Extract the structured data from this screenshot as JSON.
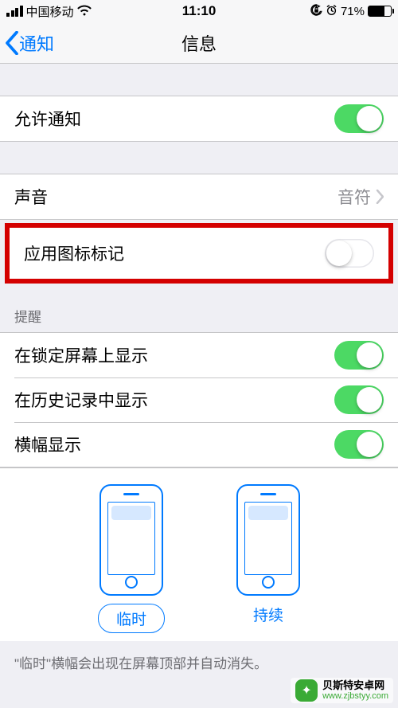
{
  "status": {
    "carrier": "中国移动",
    "wifi_icon": "wifi-icon",
    "time": "11:10",
    "lock_icon": "orientation-lock-icon",
    "alarm_icon": "alarm-icon",
    "battery_pct": "71%",
    "battery_fill_pct": 71
  },
  "nav": {
    "back_label": "通知",
    "title": "信息"
  },
  "rows": {
    "allow_notifications": {
      "label": "允许通知",
      "on": true
    },
    "sounds": {
      "label": "声音",
      "value": "音符"
    },
    "badge": {
      "label": "应用图标标记",
      "on": false
    }
  },
  "alerts_section": {
    "header": "提醒",
    "lock_screen": {
      "label": "在锁定屏幕上显示",
      "on": true
    },
    "history": {
      "label": "在历史记录中显示",
      "on": true
    },
    "banners": {
      "label": "横幅显示",
      "on": true
    }
  },
  "banner_style": {
    "temporary": "临时",
    "persistent": "持续"
  },
  "footer_note": "\"临时\"横幅会出现在屏幕顶部并自动消失。",
  "watermark": {
    "cn": "贝斯特安卓网",
    "url": "www.zjbstyy.com"
  }
}
